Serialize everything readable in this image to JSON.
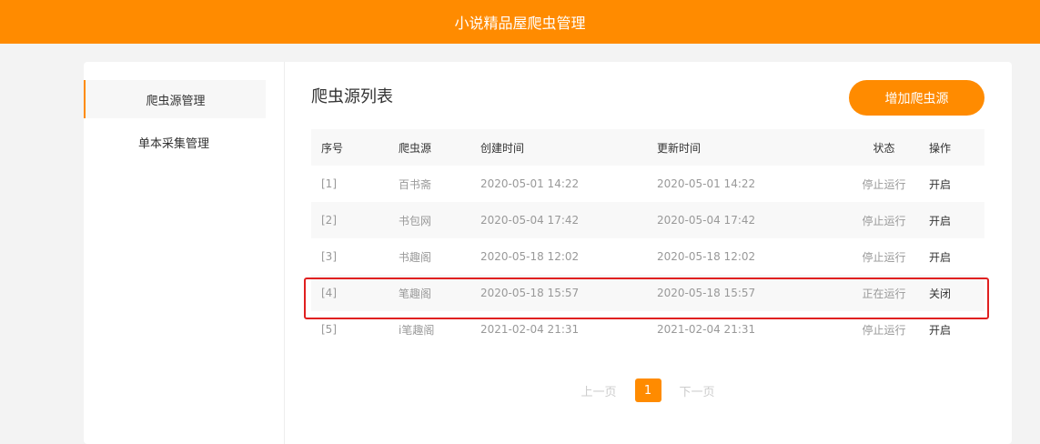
{
  "header": {
    "title": "小说精品屋爬虫管理"
  },
  "sidebar": {
    "items": [
      {
        "label": "爬虫源管理"
      },
      {
        "label": "单本采集管理"
      }
    ]
  },
  "main": {
    "title": "爬虫源列表",
    "add_button": "增加爬虫源",
    "table": {
      "headers": [
        "序号",
        "爬虫源",
        "创建时间",
        "更新时间",
        "状态",
        "操作"
      ],
      "rows": [
        [
          "[1]",
          "百书斋",
          "2020-05-01 14:22",
          "2020-05-01 14:22",
          "停止运行",
          "开启"
        ],
        [
          "[2]",
          "书包网",
          "2020-05-04 17:42",
          "2020-05-04 17:42",
          "停止运行",
          "开启"
        ],
        [
          "[3]",
          "书趣阁",
          "2020-05-18 12:02",
          "2020-05-18 12:02",
          "停止运行",
          "开启"
        ],
        [
          "[4]",
          "笔趣阁",
          "2020-05-18 15:57",
          "2020-05-18 15:57",
          "正在运行",
          "关闭"
        ],
        [
          "[5]",
          "i笔趣阁",
          "2021-02-04 21:31",
          "2021-02-04 21:31",
          "停止运行",
          "开启"
        ]
      ]
    },
    "pagination": {
      "prev": "上一页",
      "current": "1",
      "next": "下一页"
    }
  },
  "colors": {
    "accent": "#ff8b00",
    "highlight": "#e02020"
  }
}
